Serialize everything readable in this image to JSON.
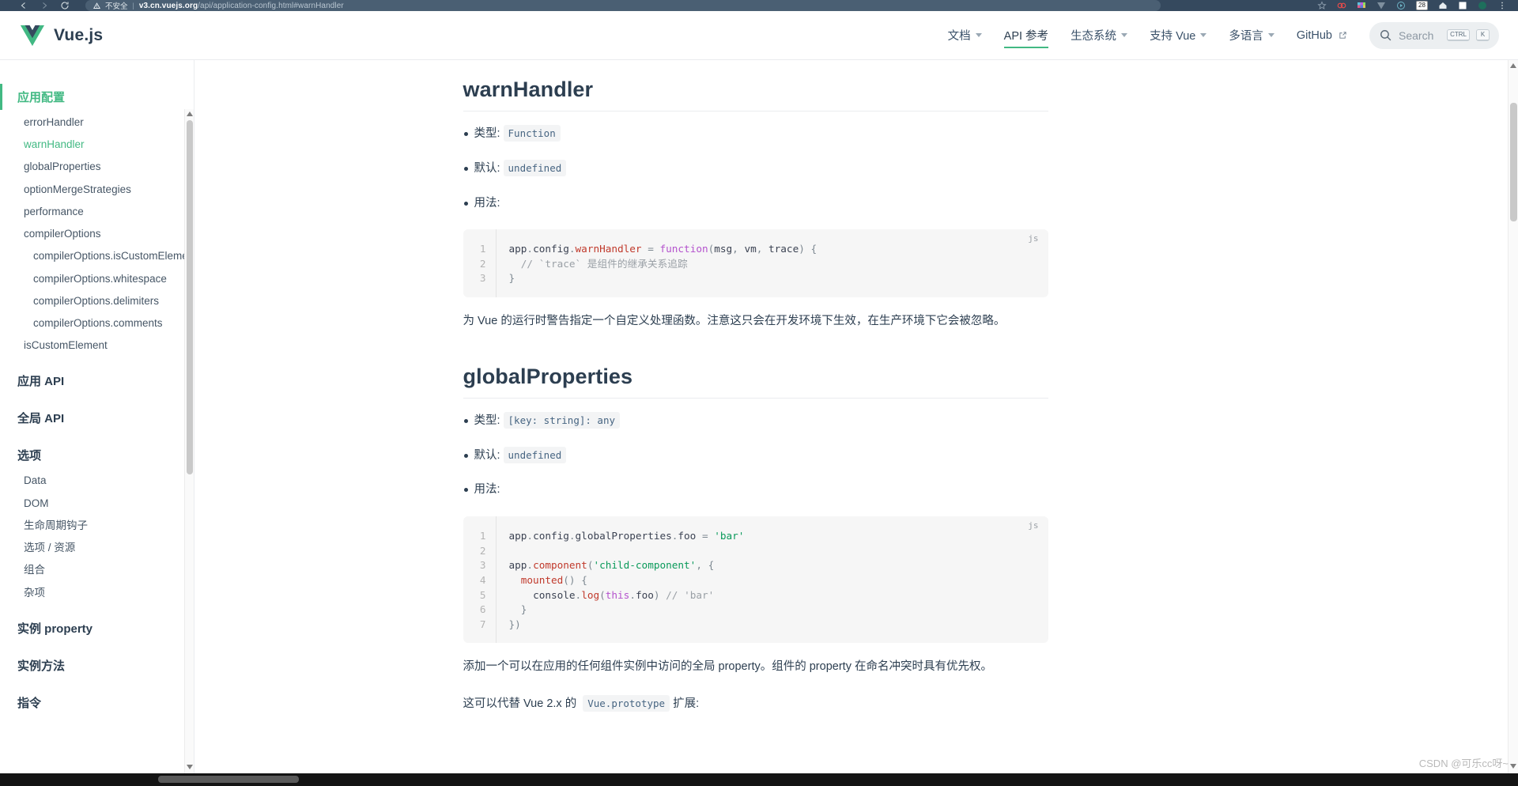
{
  "browser": {
    "security_label": "不安全",
    "url_host": "v3.cn.vuejs.org",
    "url_path": "/api/application-config.html#warnHandler",
    "extension_badge": "28"
  },
  "header": {
    "brand": "Vue.js",
    "nav": [
      {
        "label": "文档",
        "has_caret": true,
        "active": false,
        "external": false
      },
      {
        "label": "API 参考",
        "has_caret": false,
        "active": true,
        "external": false
      },
      {
        "label": "生态系统",
        "has_caret": true,
        "active": false,
        "external": false
      },
      {
        "label": "支持 Vue",
        "has_caret": true,
        "active": false,
        "external": false
      },
      {
        "label": "多语言",
        "has_caret": true,
        "active": false,
        "external": false
      },
      {
        "label": "GitHub",
        "has_caret": false,
        "active": false,
        "external": true
      }
    ],
    "search": {
      "placeholder": "Search",
      "key_modifier": "CTRL",
      "key_letter": "K"
    }
  },
  "sidebar": {
    "items": [
      {
        "label": "应用配置",
        "type": "group",
        "active": true
      },
      {
        "label": "errorHandler",
        "type": "link",
        "current": false
      },
      {
        "label": "warnHandler",
        "type": "link",
        "current": true
      },
      {
        "label": "globalProperties",
        "type": "link",
        "current": false
      },
      {
        "label": "optionMergeStrategies",
        "type": "link",
        "current": false
      },
      {
        "label": "performance",
        "type": "link",
        "current": false
      },
      {
        "label": "compilerOptions",
        "type": "link",
        "current": false
      },
      {
        "label": "compilerOptions.isCustomElement",
        "type": "sublink",
        "current": false
      },
      {
        "label": "compilerOptions.whitespace",
        "type": "sublink",
        "current": false
      },
      {
        "label": "compilerOptions.delimiters",
        "type": "sublink",
        "current": false
      },
      {
        "label": "compilerOptions.comments",
        "type": "sublink",
        "current": false
      },
      {
        "label": "isCustomElement",
        "type": "link",
        "current": false
      },
      {
        "label": "应用 API",
        "type": "group",
        "active": false
      },
      {
        "label": "全局 API",
        "type": "group",
        "active": false
      },
      {
        "label": "选项",
        "type": "group",
        "active": false
      },
      {
        "label": "Data",
        "type": "link",
        "current": false
      },
      {
        "label": "DOM",
        "type": "link",
        "current": false
      },
      {
        "label": "生命周期钩子",
        "type": "link",
        "current": false
      },
      {
        "label": "选项 / 资源",
        "type": "link",
        "current": false
      },
      {
        "label": "组合",
        "type": "link",
        "current": false
      },
      {
        "label": "杂项",
        "type": "link",
        "current": false
      },
      {
        "label": "实例 property",
        "type": "group",
        "active": false
      },
      {
        "label": "实例方法",
        "type": "group",
        "active": false
      },
      {
        "label": "指令",
        "type": "group",
        "active": false
      }
    ]
  },
  "sections": [
    {
      "title": "warnHandler",
      "meta": [
        {
          "label": "类型:",
          "value": "Function"
        },
        {
          "label": "默认:",
          "value": "undefined"
        },
        {
          "label": "用法:",
          "value": ""
        }
      ],
      "code": {
        "lang": "js",
        "lines": [
          "1",
          "2",
          "3"
        ],
        "text": "app.config.warnHandler = function(msg, vm, trace) {\n  // `trace` 是组件的继承关系追踪\n}"
      },
      "paragraph": "为 Vue 的运行时警告指定一个自定义处理函数。注意这只会在开发环境下生效，在生产环境下它会被忽略。"
    },
    {
      "title": "globalProperties",
      "meta": [
        {
          "label": "类型:",
          "value": "[key: string]: any"
        },
        {
          "label": "默认:",
          "value": "undefined"
        },
        {
          "label": "用法:",
          "value": ""
        }
      ],
      "code": {
        "lang": "js",
        "lines": [
          "1",
          "2",
          "3",
          "4",
          "5",
          "6",
          "7"
        ],
        "text": "app.config.globalProperties.foo = 'bar'\n\napp.component('child-component', {\n  mounted() {\n    console.log(this.foo) // 'bar'\n  }\n})"
      },
      "paragraph": "添加一个可以在应用的任何组件实例中访问的全局 property。组件的 property 在命名冲突时具有优先权。",
      "paragraph2_prefix": "这可以代替 Vue 2.x 的 ",
      "paragraph2_code": "Vue.prototype",
      "paragraph2_suffix": " 扩展:"
    }
  ],
  "watermark": "CSDN @可乐cc呀~",
  "colors": {
    "accent_green": "#42b983",
    "text_dark": "#2c3e50",
    "code_bg": "#f6f6f6",
    "chrome_bg": "#35495e"
  }
}
